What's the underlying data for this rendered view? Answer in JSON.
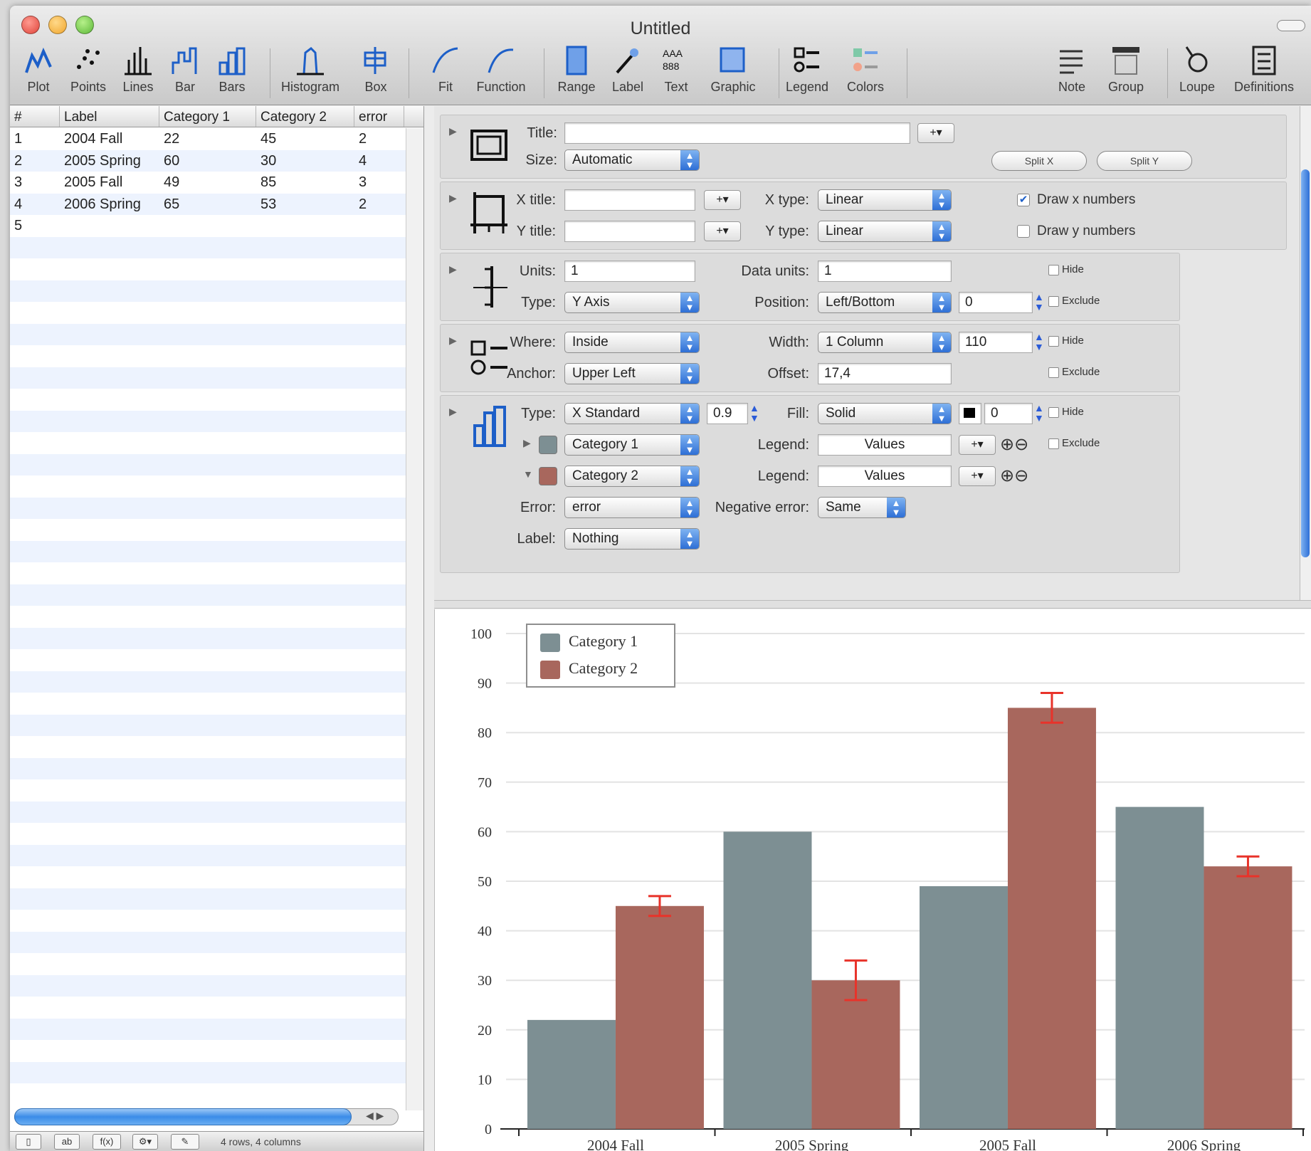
{
  "window": {
    "title": "Untitled"
  },
  "toolbar": [
    {
      "label": "Plot",
      "icon": "plot-icon"
    },
    {
      "label": "Points",
      "icon": "points-icon"
    },
    {
      "label": "Lines",
      "icon": "lines-icon"
    },
    {
      "label": "Bar",
      "icon": "bar-icon"
    },
    {
      "label": "Bars",
      "icon": "bars-icon"
    },
    {
      "label": "Histogram",
      "icon": "histogram-icon"
    },
    {
      "label": "Box",
      "icon": "box-icon"
    },
    {
      "label": "Fit",
      "icon": "fit-icon"
    },
    {
      "label": "Function",
      "icon": "function-icon"
    },
    {
      "label": "Range",
      "icon": "range-icon"
    },
    {
      "label": "Label",
      "icon": "label-icon"
    },
    {
      "label": "Text",
      "icon": "text-icon"
    },
    {
      "label": "Graphic",
      "icon": "graphic-icon"
    },
    {
      "label": "Legend",
      "icon": "legend-icon"
    },
    {
      "label": "Colors",
      "icon": "colors-icon"
    },
    {
      "label": "Note",
      "icon": "note-icon"
    },
    {
      "label": "Group",
      "icon": "group-icon"
    },
    {
      "label": "Loupe",
      "icon": "loupe-icon"
    },
    {
      "label": "Definitions",
      "icon": "definitions-icon"
    }
  ],
  "table": {
    "headers": [
      "#",
      "Label",
      "Category 1",
      "Category 2",
      "error"
    ],
    "rows": [
      [
        "1",
        "2004 Fall",
        "22",
        "45",
        "2"
      ],
      [
        "2",
        "2005 Spring",
        "60",
        "30",
        "4"
      ],
      [
        "3",
        "2005 Fall",
        "49",
        "85",
        "3"
      ],
      [
        "4",
        "2006 Spring",
        "65",
        "53",
        "2"
      ],
      [
        "5",
        "",
        "",
        "",
        ""
      ]
    ],
    "status": "4 rows, 4 columns"
  },
  "inspector": {
    "canvas": {
      "title_label": "Title:",
      "title_value": "",
      "plus": "+▾",
      "size_label": "Size:",
      "size_value": "Automatic",
      "split_x": "Split X",
      "split_y": "Split Y"
    },
    "axes": {
      "xtitle_label": "X title:",
      "ytitle_label": "Y title:",
      "xtype_label": "X type:",
      "xtype_value": "Linear",
      "ytype_label": "Y type:",
      "ytype_value": "Linear",
      "draw_x": "Draw x numbers",
      "draw_x_checked": true,
      "draw_y": "Draw y numbers",
      "draw_y_checked": false
    },
    "axis": {
      "units_label": "Units:",
      "units_value": "1",
      "data_units_label": "Data units:",
      "data_units_value": "1",
      "type_label": "Type:",
      "type_value": "Y Axis",
      "position_label": "Position:",
      "position_value": "Left/Bottom",
      "position_offset": "0",
      "hide": "Hide",
      "exclude": "Exclude"
    },
    "legend": {
      "where_label": "Where:",
      "where_value": "Inside",
      "width_label": "Width:",
      "width_value": "1 Column",
      "width_px": "110",
      "anchor_label": "Anchor:",
      "anchor_value": "Upper Left",
      "offset_label": "Offset:",
      "offset_value": "17,4",
      "hide": "Hide",
      "exclude": "Exclude"
    },
    "bars": {
      "type_label": "Type:",
      "type_value": "X Standard",
      "spacing": "0.9",
      "fill_label": "Fill:",
      "fill_value": "Solid",
      "line_width": "0",
      "series1": "Category 1",
      "series2": "Category 2",
      "legend_label": "Legend:",
      "legend_value": "Values",
      "error_label": "Error:",
      "error_value": "error",
      "neg_error_label": "Negative error:",
      "neg_error_value": "Same",
      "label_label": "Label:",
      "label_value": "Nothing",
      "hide": "Hide",
      "exclude": "Exclude"
    }
  },
  "colors": {
    "series1": "#7d8f93",
    "series2": "#a8675d",
    "error": "#e8332a",
    "accent": "#2e6fd6"
  },
  "chart_data": {
    "type": "bar",
    "categories": [
      "2004 Fall",
      "2005 Spring",
      "2005 Fall",
      "2006 Spring"
    ],
    "series": [
      {
        "name": "Category 1",
        "values": [
          22,
          60,
          49,
          65
        ]
      },
      {
        "name": "Category 2",
        "values": [
          45,
          30,
          85,
          53
        ],
        "error": [
          2,
          4,
          3,
          2
        ]
      }
    ],
    "ylim": [
      0,
      100
    ],
    "yticks": [
      0,
      10,
      20,
      30,
      40,
      50,
      60,
      70,
      80,
      90,
      100
    ],
    "grid": true,
    "legend_position": "upper-left"
  }
}
